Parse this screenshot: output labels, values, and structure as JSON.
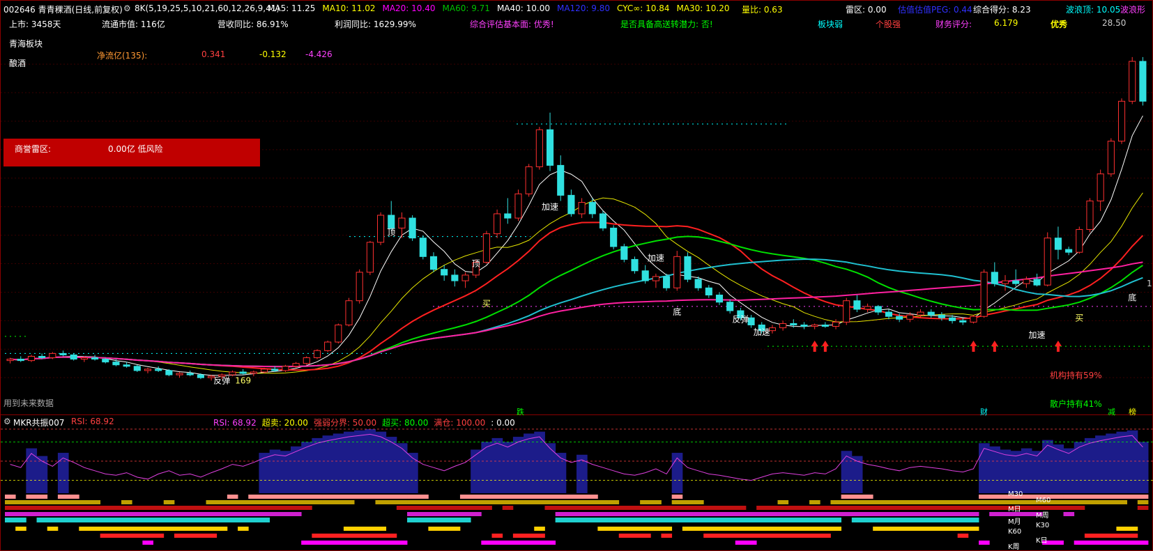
{
  "header": {
    "code_title": "002646 青青稞酒(日线,前复权)",
    "indicator_name": "8K(5,19,25,5,10,21,60,12,26,9,41)",
    "ma_items": [
      {
        "label": "MA5: 11.25",
        "color": "#ffffff"
      },
      {
        "label": "MA10: 11.02",
        "color": "#ffff00"
      },
      {
        "label": "MA20: 10.40",
        "color": "#ff00ff"
      },
      {
        "label": "MA60: 9.71",
        "color": "#00c000"
      },
      {
        "label": "MA40: 10.00",
        "color": "#ffffff"
      },
      {
        "label": "MA120: 9.80",
        "color": "#3030ff"
      },
      {
        "label": "CYC∞: 10.84",
        "color": "#ffff00"
      },
      {
        "label": "MA30: 10.20",
        "color": "#ffff00"
      }
    ],
    "volume_ratio": "量比: 0.63",
    "radar": "雷区: 0.00",
    "peg": "估值估值PEG: 0.44",
    "score": "综合得分: 8.23",
    "wave_top": "波浪顶: 10.05",
    "wave_label": "波浪形"
  },
  "info": {
    "listed": "上市: 3458天",
    "market_cap": "流通市值: 116亿",
    "revenue_yoy": "营收同比: 86.91%",
    "profit_yoy": "利润同比: 1629.99%",
    "evaluation": "综合评估基本面: 优秀!",
    "potential": "是否具备高送转潜力: 否!",
    "sector_weak": "板块弱",
    "stock_strong": "个股强",
    "finance_label": "财务评分:",
    "finance_value": "6.179",
    "excellent": "优秀",
    "sector1": "青海板块",
    "sector2": "酿酒",
    "net_flow_label": "净流亿(135):",
    "net_flow_1": "0.341",
    "net_flow_2": "-0.132",
    "net_flow_3": "-4.426",
    "goodwill_label": "商誉雷区:",
    "goodwill_value": "0.00亿 低风险",
    "future_data": "用到未来数据",
    "inst_hold": "机构持有59%",
    "retail_hold": "散户持有41%",
    "price_top": "28.50",
    "price_right": "1",
    "fall_tag": "跌",
    "cai_tag": "财",
    "jian_tag": "减",
    "bang_tag": "榜"
  },
  "sub": {
    "name": "MKR共振007",
    "rsi_title": "RSI: 68.92",
    "items": [
      {
        "label": "RSI: 68.92",
        "color": "#ff40ff"
      },
      {
        "label": "超卖: 20.00",
        "color": "#ffff00"
      },
      {
        "label": "强弱分界: 50.00",
        "color": "#ff4040"
      },
      {
        "label": "超买: 80.00",
        "color": "#00ff00"
      },
      {
        "label": "满仓: 100.00",
        "color": "#ff4040"
      },
      {
        "label": ": 0.00",
        "color": "#ffffff"
      }
    ],
    "right_labels": [
      "M30",
      "M60",
      "M日",
      "M周",
      "M月",
      "K30",
      "K60",
      "K日",
      "K周"
    ]
  },
  "chart_data": {
    "type": "candlestick",
    "title": "002646 青青稞酒(日线,前复权)",
    "ylim": [
      4.2,
      30.5
    ],
    "marked_high": 28.5,
    "annotations": [
      "顶",
      "顶",
      "买",
      "加速",
      "加速",
      "底",
      "反弹",
      "加速",
      "加速",
      "底",
      "买",
      "顶",
      "反弹",
      "169"
    ],
    "candles": [
      [
        7.2,
        7.4,
        7.0,
        7.3
      ],
      [
        7.3,
        7.5,
        7.1,
        7.2
      ],
      [
        7.2,
        7.6,
        7.1,
        7.5
      ],
      [
        7.5,
        7.7,
        7.3,
        7.4
      ],
      [
        7.4,
        7.8,
        7.3,
        7.7
      ],
      [
        7.7,
        7.9,
        7.5,
        7.6
      ],
      [
        7.6,
        7.7,
        7.2,
        7.3
      ],
      [
        7.3,
        7.5,
        7.1,
        7.4
      ],
      [
        7.4,
        7.6,
        7.2,
        7.3
      ],
      [
        7.3,
        7.4,
        7.0,
        7.1
      ],
      [
        7.1,
        7.3,
        6.8,
        6.9
      ],
      [
        6.9,
        7.1,
        6.7,
        6.8
      ],
      [
        6.8,
        6.9,
        6.4,
        6.5
      ],
      [
        6.5,
        6.7,
        6.3,
        6.6
      ],
      [
        6.6,
        6.8,
        6.4,
        6.5
      ],
      [
        6.5,
        6.6,
        6.1,
        6.2
      ],
      [
        6.2,
        6.4,
        6.0,
        6.3
      ],
      [
        6.3,
        6.5,
        6.1,
        6.2
      ],
      [
        6.2,
        6.3,
        5.9,
        6.0
      ],
      [
        6.0,
        6.2,
        5.8,
        6.1
      ],
      [
        6.1,
        6.3,
        5.9,
        6.2
      ],
      [
        6.2,
        6.5,
        6.1,
        6.4
      ],
      [
        6.4,
        6.6,
        6.2,
        6.3
      ],
      [
        6.3,
        6.5,
        6.1,
        6.4
      ],
      [
        6.4,
        6.7,
        6.3,
        6.6
      ],
      [
        6.6,
        6.8,
        6.4,
        6.5
      ],
      [
        6.5,
        6.9,
        6.4,
        6.8
      ],
      [
        6.8,
        7.1,
        6.7,
        7.0
      ],
      [
        7.0,
        7.5,
        6.9,
        7.4
      ],
      [
        7.4,
        8.0,
        7.3,
        7.9
      ],
      [
        7.9,
        8.6,
        7.8,
        8.5
      ],
      [
        8.5,
        9.8,
        8.4,
        9.7
      ],
      [
        9.7,
        11.6,
        9.6,
        11.4
      ],
      [
        11.4,
        13.6,
        11.2,
        13.4
      ],
      [
        13.4,
        15.6,
        13.2,
        15.5
      ],
      [
        15.5,
        17.6,
        15.3,
        17.4
      ],
      [
        17.4,
        18.4,
        16.3,
        16.5
      ],
      [
        16.5,
        17.6,
        15.8,
        17.2
      ],
      [
        17.2,
        17.4,
        15.6,
        15.8
      ],
      [
        15.8,
        16.0,
        14.3,
        14.5
      ],
      [
        14.5,
        14.8,
        13.4,
        13.6
      ],
      [
        13.6,
        13.9,
        12.8,
        13.2
      ],
      [
        13.2,
        13.6,
        12.4,
        12.8
      ],
      [
        12.8,
        13.4,
        12.3,
        13.2
      ],
      [
        13.2,
        14.3,
        13.0,
        14.1
      ],
      [
        14.1,
        16.3,
        14.0,
        16.1
      ],
      [
        16.1,
        17.8,
        15.8,
        17.5
      ],
      [
        17.5,
        18.6,
        16.8,
        17.2
      ],
      [
        17.2,
        19.2,
        17.0,
        18.9
      ],
      [
        18.9,
        21.0,
        18.7,
        20.8
      ],
      [
        20.8,
        23.6,
        20.6,
        23.4
      ],
      [
        23.4,
        24.6,
        20.5,
        20.9
      ],
      [
        20.9,
        21.6,
        18.4,
        18.8
      ],
      [
        18.8,
        19.2,
        17.3,
        17.5
      ],
      [
        17.5,
        18.6,
        17.2,
        18.3
      ],
      [
        18.3,
        18.6,
        17.2,
        17.5
      ],
      [
        17.5,
        17.7,
        16.3,
        16.5
      ],
      [
        16.5,
        16.7,
        15.0,
        15.2
      ],
      [
        15.2,
        15.4,
        14.1,
        14.3
      ],
      [
        14.3,
        14.5,
        13.3,
        13.5
      ],
      [
        13.5,
        13.9,
        12.6,
        12.8
      ],
      [
        12.8,
        13.3,
        12.3,
        13.1
      ],
      [
        13.1,
        13.3,
        12.1,
        12.3
      ],
      [
        12.3,
        14.9,
        12.1,
        14.5
      ],
      [
        14.5,
        14.8,
        12.7,
        12.9
      ],
      [
        12.9,
        13.1,
        12.1,
        12.3
      ],
      [
        12.3,
        12.5,
        11.6,
        11.8
      ],
      [
        11.8,
        12.0,
        11.1,
        11.3
      ],
      [
        11.3,
        11.5,
        10.5,
        10.7
      ],
      [
        10.7,
        10.9,
        10.0,
        10.2
      ],
      [
        10.2,
        10.4,
        9.5,
        9.7
      ],
      [
        9.7,
        9.9,
        9.1,
        9.3
      ],
      [
        9.3,
        9.7,
        9.1,
        9.5
      ],
      [
        9.5,
        10.0,
        9.3,
        9.8
      ],
      [
        9.8,
        10.1,
        9.5,
        9.7
      ],
      [
        9.7,
        9.9,
        9.4,
        9.6
      ],
      [
        9.6,
        9.8,
        9.4,
        9.7
      ],
      [
        9.7,
        9.9,
        9.5,
        9.6
      ],
      [
        9.6,
        10.1,
        9.4,
        9.9
      ],
      [
        9.9,
        11.6,
        9.7,
        11.4
      ],
      [
        11.4,
        11.8,
        10.6,
        10.8
      ],
      [
        10.8,
        11.2,
        10.6,
        11.0
      ],
      [
        11.0,
        11.1,
        10.4,
        10.6
      ],
      [
        10.6,
        10.8,
        10.1,
        10.3
      ],
      [
        10.3,
        10.5,
        9.9,
        10.1
      ],
      [
        10.1,
        10.6,
        9.9,
        10.4
      ],
      [
        10.4,
        10.8,
        10.2,
        10.6
      ],
      [
        10.6,
        10.8,
        10.2,
        10.4
      ],
      [
        10.4,
        10.6,
        10.0,
        10.2
      ],
      [
        10.2,
        10.4,
        9.8,
        10.0
      ],
      [
        10.0,
        10.2,
        9.7,
        9.9
      ],
      [
        9.9,
        10.4,
        9.8,
        10.3
      ],
      [
        10.3,
        13.6,
        10.2,
        13.4
      ],
      [
        13.4,
        14.1,
        12.4,
        12.6
      ],
      [
        12.6,
        13.2,
        12.1,
        12.8
      ],
      [
        12.8,
        13.6,
        12.4,
        12.6
      ],
      [
        12.6,
        13.1,
        12.3,
        12.9
      ],
      [
        12.9,
        13.3,
        12.4,
        12.5
      ],
      [
        12.5,
        16.2,
        12.4,
        15.8
      ],
      [
        15.8,
        16.6,
        14.3,
        15.0
      ],
      [
        15.0,
        15.2,
        14.6,
        14.8
      ],
      [
        14.8,
        16.6,
        14.7,
        16.4
      ],
      [
        16.4,
        18.6,
        16.2,
        18.4
      ],
      [
        18.4,
        20.6,
        17.7,
        20.3
      ],
      [
        20.3,
        22.8,
        20.1,
        22.6
      ],
      [
        22.6,
        25.6,
        22.4,
        25.4
      ],
      [
        25.4,
        28.5,
        25.2,
        28.2
      ],
      [
        28.2,
        28.5,
        25.1,
        25.4
      ]
    ],
    "rsi": [
      45,
      40,
      62,
      50,
      42,
      55,
      48,
      40,
      35,
      30,
      28,
      32,
      25,
      22,
      30,
      35,
      28,
      30,
      25,
      32,
      38,
      45,
      42,
      48,
      55,
      60,
      58,
      65,
      72,
      78,
      82,
      85,
      88,
      90,
      92,
      88,
      80,
      70,
      55,
      45,
      40,
      35,
      42,
      48,
      60,
      72,
      78,
      72,
      80,
      85,
      88,
      70,
      55,
      48,
      52,
      45,
      40,
      35,
      30,
      28,
      32,
      38,
      30,
      55,
      40,
      35,
      30,
      28,
      25,
      22,
      20,
      25,
      30,
      32,
      30,
      28,
      32,
      30,
      38,
      58,
      50,
      45,
      42,
      38,
      35,
      40,
      42,
      40,
      38,
      35,
      33,
      38,
      70,
      65,
      60,
      58,
      62,
      58,
      75,
      68,
      62,
      72,
      78,
      82,
      85,
      88,
      90,
      72
    ]
  }
}
